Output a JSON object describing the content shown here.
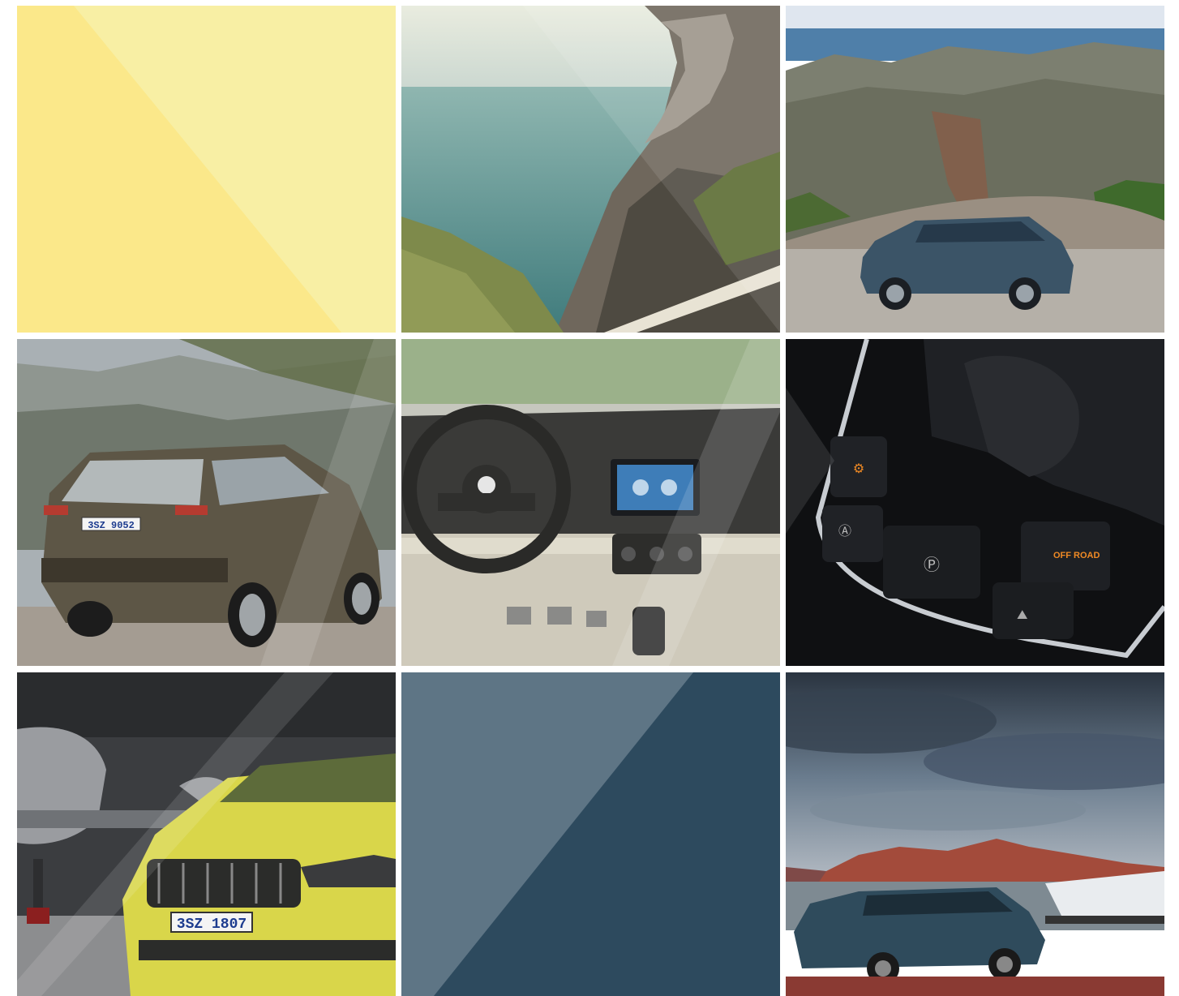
{
  "grid": {
    "tiles": [
      {
        "id": "t1",
        "kind": "color-block",
        "colors": {
          "base": "#fbe98a",
          "overlay": "#f8f0a6"
        }
      },
      {
        "id": "t2",
        "kind": "photo",
        "subject": "sea cliff coastline"
      },
      {
        "id": "t3",
        "kind": "photo",
        "subject": "blue SUV on mountain road"
      },
      {
        "id": "t4",
        "kind": "photo",
        "subject": "bronze SUV rear view",
        "plate": "3SZ 9052"
      },
      {
        "id": "t5",
        "kind": "photo",
        "subject": "car dashboard interior"
      },
      {
        "id": "t6",
        "kind": "photo",
        "subject": "center console buttons",
        "button_labels": {
          "offroad": "OFF ROAD"
        }
      },
      {
        "id": "t7",
        "kind": "photo",
        "subject": "yellow car and aircraft",
        "plate": "3SZ 1807"
      },
      {
        "id": "t8",
        "kind": "color-block",
        "colors": {
          "base": "#2e4a5e",
          "overlay": "#5e7585"
        }
      },
      {
        "id": "t9",
        "kind": "photo",
        "subject": "SUV towing boat at dusk"
      }
    ]
  }
}
